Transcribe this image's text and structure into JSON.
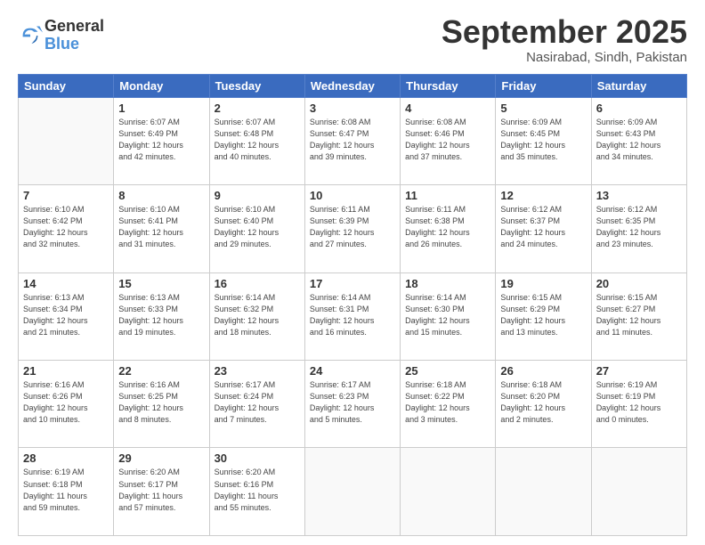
{
  "logo": {
    "general": "General",
    "blue": "Blue"
  },
  "title": "September 2025",
  "location": "Nasirabad, Sindh, Pakistan",
  "days_of_week": [
    "Sunday",
    "Monday",
    "Tuesday",
    "Wednesday",
    "Thursday",
    "Friday",
    "Saturday"
  ],
  "weeks": [
    [
      {
        "day": "",
        "info": ""
      },
      {
        "day": "1",
        "info": "Sunrise: 6:07 AM\nSunset: 6:49 PM\nDaylight: 12 hours\nand 42 minutes."
      },
      {
        "day": "2",
        "info": "Sunrise: 6:07 AM\nSunset: 6:48 PM\nDaylight: 12 hours\nand 40 minutes."
      },
      {
        "day": "3",
        "info": "Sunrise: 6:08 AM\nSunset: 6:47 PM\nDaylight: 12 hours\nand 39 minutes."
      },
      {
        "day": "4",
        "info": "Sunrise: 6:08 AM\nSunset: 6:46 PM\nDaylight: 12 hours\nand 37 minutes."
      },
      {
        "day": "5",
        "info": "Sunrise: 6:09 AM\nSunset: 6:45 PM\nDaylight: 12 hours\nand 35 minutes."
      },
      {
        "day": "6",
        "info": "Sunrise: 6:09 AM\nSunset: 6:43 PM\nDaylight: 12 hours\nand 34 minutes."
      }
    ],
    [
      {
        "day": "7",
        "info": "Sunrise: 6:10 AM\nSunset: 6:42 PM\nDaylight: 12 hours\nand 32 minutes."
      },
      {
        "day": "8",
        "info": "Sunrise: 6:10 AM\nSunset: 6:41 PM\nDaylight: 12 hours\nand 31 minutes."
      },
      {
        "day": "9",
        "info": "Sunrise: 6:10 AM\nSunset: 6:40 PM\nDaylight: 12 hours\nand 29 minutes."
      },
      {
        "day": "10",
        "info": "Sunrise: 6:11 AM\nSunset: 6:39 PM\nDaylight: 12 hours\nand 27 minutes."
      },
      {
        "day": "11",
        "info": "Sunrise: 6:11 AM\nSunset: 6:38 PM\nDaylight: 12 hours\nand 26 minutes."
      },
      {
        "day": "12",
        "info": "Sunrise: 6:12 AM\nSunset: 6:37 PM\nDaylight: 12 hours\nand 24 minutes."
      },
      {
        "day": "13",
        "info": "Sunrise: 6:12 AM\nSunset: 6:35 PM\nDaylight: 12 hours\nand 23 minutes."
      }
    ],
    [
      {
        "day": "14",
        "info": "Sunrise: 6:13 AM\nSunset: 6:34 PM\nDaylight: 12 hours\nand 21 minutes."
      },
      {
        "day": "15",
        "info": "Sunrise: 6:13 AM\nSunset: 6:33 PM\nDaylight: 12 hours\nand 19 minutes."
      },
      {
        "day": "16",
        "info": "Sunrise: 6:14 AM\nSunset: 6:32 PM\nDaylight: 12 hours\nand 18 minutes."
      },
      {
        "day": "17",
        "info": "Sunrise: 6:14 AM\nSunset: 6:31 PM\nDaylight: 12 hours\nand 16 minutes."
      },
      {
        "day": "18",
        "info": "Sunrise: 6:14 AM\nSunset: 6:30 PM\nDaylight: 12 hours\nand 15 minutes."
      },
      {
        "day": "19",
        "info": "Sunrise: 6:15 AM\nSunset: 6:29 PM\nDaylight: 12 hours\nand 13 minutes."
      },
      {
        "day": "20",
        "info": "Sunrise: 6:15 AM\nSunset: 6:27 PM\nDaylight: 12 hours\nand 11 minutes."
      }
    ],
    [
      {
        "day": "21",
        "info": "Sunrise: 6:16 AM\nSunset: 6:26 PM\nDaylight: 12 hours\nand 10 minutes."
      },
      {
        "day": "22",
        "info": "Sunrise: 6:16 AM\nSunset: 6:25 PM\nDaylight: 12 hours\nand 8 minutes."
      },
      {
        "day": "23",
        "info": "Sunrise: 6:17 AM\nSunset: 6:24 PM\nDaylight: 12 hours\nand 7 minutes."
      },
      {
        "day": "24",
        "info": "Sunrise: 6:17 AM\nSunset: 6:23 PM\nDaylight: 12 hours\nand 5 minutes."
      },
      {
        "day": "25",
        "info": "Sunrise: 6:18 AM\nSunset: 6:22 PM\nDaylight: 12 hours\nand 3 minutes."
      },
      {
        "day": "26",
        "info": "Sunrise: 6:18 AM\nSunset: 6:20 PM\nDaylight: 12 hours\nand 2 minutes."
      },
      {
        "day": "27",
        "info": "Sunrise: 6:19 AM\nSunset: 6:19 PM\nDaylight: 12 hours\nand 0 minutes."
      }
    ],
    [
      {
        "day": "28",
        "info": "Sunrise: 6:19 AM\nSunset: 6:18 PM\nDaylight: 11 hours\nand 59 minutes."
      },
      {
        "day": "29",
        "info": "Sunrise: 6:20 AM\nSunset: 6:17 PM\nDaylight: 11 hours\nand 57 minutes."
      },
      {
        "day": "30",
        "info": "Sunrise: 6:20 AM\nSunset: 6:16 PM\nDaylight: 11 hours\nand 55 minutes."
      },
      {
        "day": "",
        "info": ""
      },
      {
        "day": "",
        "info": ""
      },
      {
        "day": "",
        "info": ""
      },
      {
        "day": "",
        "info": ""
      }
    ]
  ]
}
